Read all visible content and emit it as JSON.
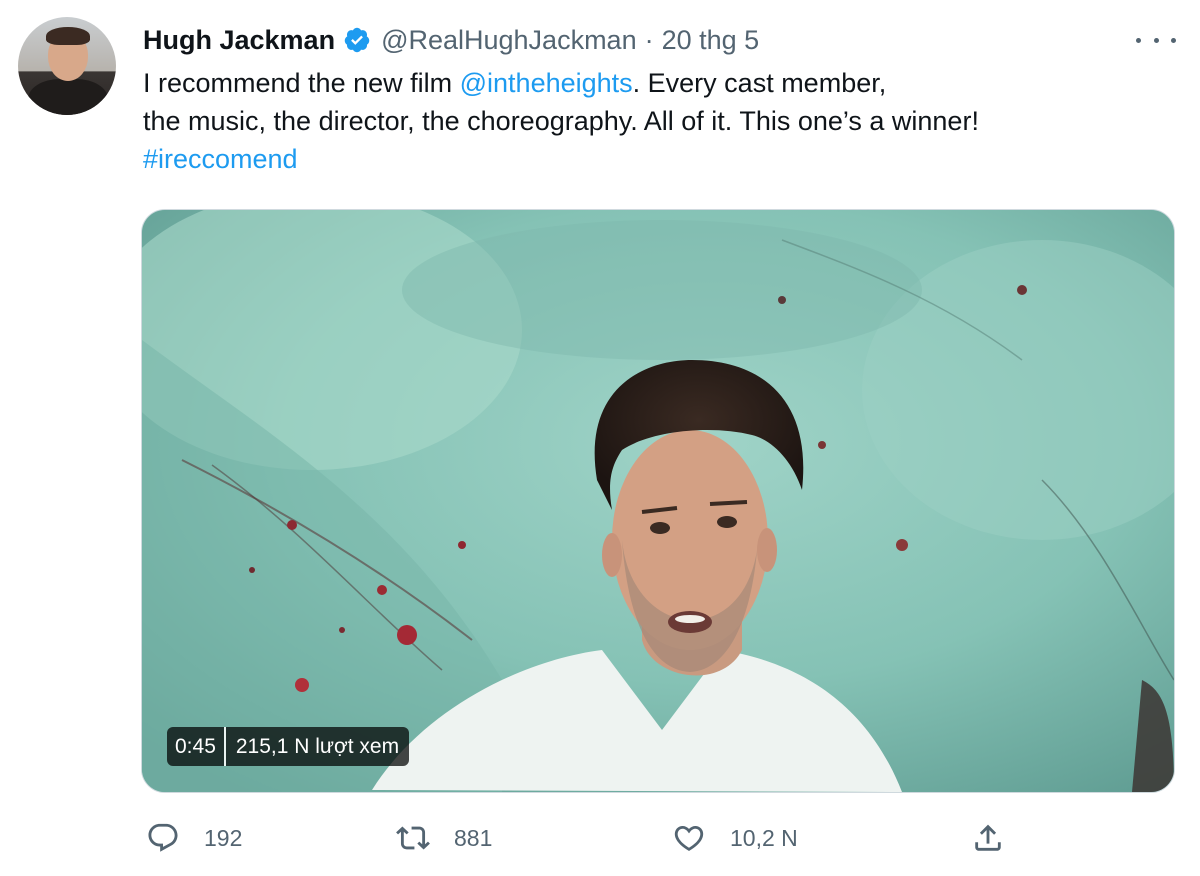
{
  "author": {
    "display_name": "Hugh Jackman",
    "handle": "@RealHughJackman",
    "separator": "·",
    "date": "20 thg 5",
    "verified": true
  },
  "tweet": {
    "line1_prefix": "I recommend the new film ",
    "mention": "@intheheights",
    "line1_suffix": ". Every cast member,",
    "line2": "the music, the director, the choreography. All of it. This one’s a winner!",
    "hashtag": "#ireccomend"
  },
  "video": {
    "duration": "0:45",
    "views": "215,1 N lượt xem"
  },
  "actions": {
    "reply_count": "192",
    "retweet_count": "881",
    "like_count": "10,2 N"
  },
  "colors": {
    "link": "#1d9bf0",
    "secondary_text": "#536471",
    "verified_badge": "#1d9bf0"
  },
  "icons": {
    "more": "more-icon",
    "verified": "verified-badge-icon",
    "reply": "reply-icon",
    "retweet": "retweet-icon",
    "like": "heart-icon",
    "share": "share-icon"
  }
}
